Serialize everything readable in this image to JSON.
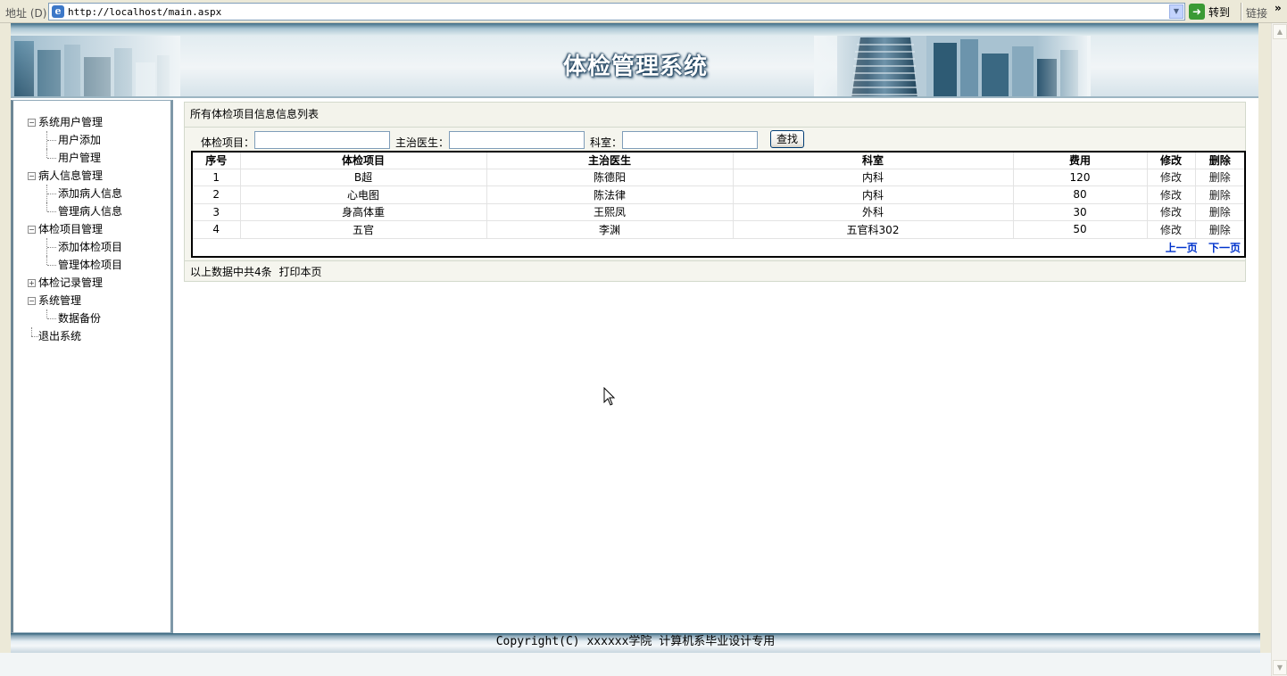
{
  "browser": {
    "address_label": "地址 (D)",
    "url": "http://localhost/main.aspx",
    "go_label": "转到",
    "links_label": "链接",
    "more": "»"
  },
  "banner": {
    "title": "体检管理系统"
  },
  "sidebar": {
    "groups": [
      {
        "label": "系统用户管理",
        "toggle": "−",
        "items": [
          "用户添加",
          "用户管理"
        ]
      },
      {
        "label": "病人信息管理",
        "toggle": "−",
        "items": [
          "添加病人信息",
          "管理病人信息"
        ]
      },
      {
        "label": "体检项目管理",
        "toggle": "−",
        "items": [
          "添加体检项目",
          "管理体检项目"
        ]
      },
      {
        "label": "体检记录管理",
        "toggle": "+",
        "items": []
      },
      {
        "label": "系统管理",
        "toggle": "−",
        "items": [
          "数据备份"
        ]
      }
    ],
    "exit_label": "退出系统"
  },
  "panel": {
    "title": "所有体检项目信息信息列表",
    "search": {
      "item_label": "体检项目：",
      "doctor_label": "主治医生：",
      "dept_label": "科室：",
      "item_value": "",
      "doctor_value": "",
      "dept_value": "",
      "button": "查找"
    },
    "table": {
      "headers": [
        "序号",
        "体检项目",
        "主治医生",
        "科室",
        "费用",
        "修改",
        "删除"
      ],
      "rows": [
        [
          "1",
          "B超",
          "陈德阳",
          "内科",
          "120",
          "修改",
          "删除"
        ],
        [
          "2",
          "心电图",
          "陈法律",
          "内科",
          "80",
          "修改",
          "删除"
        ],
        [
          "3",
          "身高体重",
          "王熙凤",
          "外科",
          "30",
          "修改",
          "删除"
        ],
        [
          "4",
          "五官",
          "李渊",
          "五官科302",
          "50",
          "修改",
          "删除"
        ]
      ]
    },
    "pager": {
      "prev": "上一页",
      "next": "下一页"
    },
    "footer_text": "以上数据中共4条",
    "print_label": "打印本页"
  },
  "footer": {
    "copyright": "Copyright(C) xxxxxx学院 计算机系毕业设计专用"
  },
  "colors": {
    "link_blue": "#0033CC",
    "banner_blue": "#3E6D86",
    "page_bg": "#ECE9D8"
  }
}
